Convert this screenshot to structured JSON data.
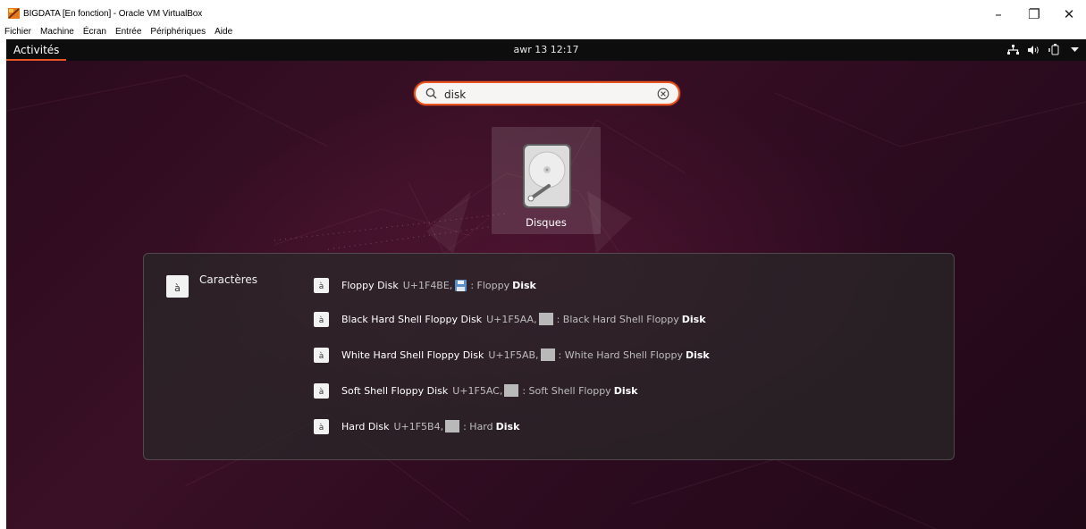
{
  "host": {
    "window_title": "BIGDATA [En fonction] - Oracle VM VirtualBox",
    "menu": [
      "Fichier",
      "Machine",
      "Écran",
      "Entrée",
      "Périphériques",
      "Aide"
    ],
    "controls": {
      "minimize": "–",
      "restore": "❐",
      "close": "✕"
    }
  },
  "topbar": {
    "activities": "Activités",
    "clock": "awr 13  12:17",
    "tray_icons": [
      "network-icon",
      "volume-icon",
      "power-icon",
      "dropdown-arrow-icon"
    ]
  },
  "search": {
    "value": "disk",
    "icon": "search-icon",
    "clear_icon": "clear-icon"
  },
  "app_result": {
    "label": "Disques",
    "icon": "disk-utility-icon"
  },
  "results": {
    "provider_name": "Caractères",
    "provider_icon_glyph": "à",
    "items": [
      {
        "glyph": "à",
        "name": "Floppy Disk",
        "code": "U+1F4BE,",
        "desc": ": Floppy",
        "desc_bold": "Disk",
        "preview": "floppy-emoji"
      },
      {
        "glyph": "à",
        "name": "Black Hard Shell Floppy Disk",
        "code": "U+1F5AA,",
        "desc": ": Black Hard Shell Floppy",
        "desc_bold": "Disk",
        "preview": "swatch"
      },
      {
        "glyph": "à",
        "name": "White Hard Shell Floppy Disk",
        "code": "U+1F5AB,",
        "desc": ": White Hard Shell Floppy",
        "desc_bold": "Disk",
        "preview": "swatch"
      },
      {
        "glyph": "à",
        "name": "Soft Shell Floppy Disk",
        "code": "U+1F5AC,",
        "desc": ": Soft Shell Floppy",
        "desc_bold": "Disk",
        "preview": "swatch"
      },
      {
        "glyph": "à",
        "name": "Hard Disk",
        "code": "U+1F5B4,",
        "desc": ": Hard",
        "desc_bold": "Disk",
        "preview": "swatch"
      }
    ]
  },
  "colors": {
    "accent": "#e95420",
    "background_dark": "#2c0b1f",
    "topbar": "#0d0d0d"
  }
}
